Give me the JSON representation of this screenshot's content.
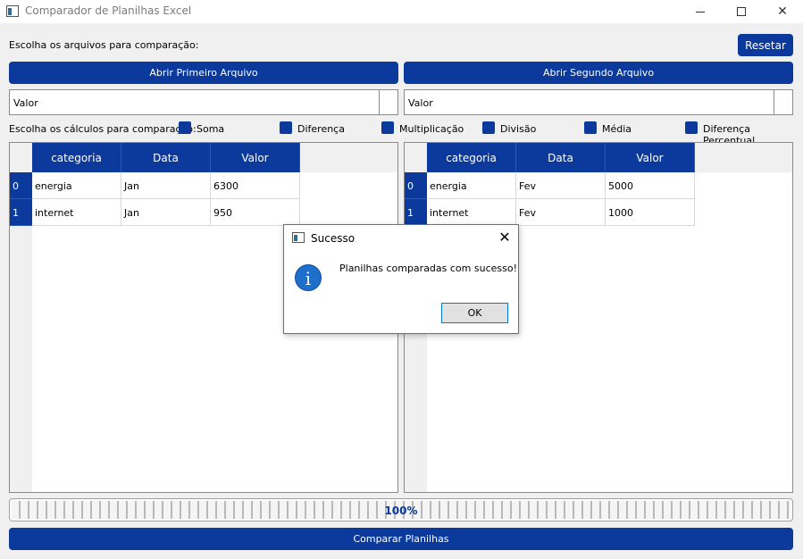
{
  "window": {
    "title": "Comparador de Planilhas Excel",
    "app_icon": "spreadsheet-icon"
  },
  "header": {
    "choose_files_label": "Escolha os arquivos para comparação:",
    "reset_button": "Resetar"
  },
  "files": {
    "open_first": "Abrir Primeiro Arquivo",
    "open_second": "Abrir Segundo Arquivo"
  },
  "columns_select": {
    "first_value": "Valor",
    "second_value": "Valor"
  },
  "calculations": {
    "label": "Escolha os cálculos para comparação:",
    "options": [
      "Soma",
      "Diferença",
      "Multiplicação",
      "Divisão",
      "Média",
      "Diferença Percentual"
    ]
  },
  "table1": {
    "headers": [
      "categoria",
      "Data",
      "Valor"
    ],
    "row_headers": [
      "0",
      "1"
    ],
    "rows": [
      [
        "energia",
        "Jan",
        "6300"
      ],
      [
        "internet",
        "Jan",
        "950"
      ]
    ]
  },
  "table2": {
    "headers": [
      "categoria",
      "Data",
      "Valor"
    ],
    "row_headers": [
      "0",
      "1"
    ],
    "rows": [
      [
        "energia",
        "Fev",
        "5000"
      ],
      [
        "internet",
        "Fev",
        "1000"
      ]
    ]
  },
  "progress": {
    "value": 100,
    "text": "100%"
  },
  "compare_button": "Comparar Planilhas",
  "dialog": {
    "title": "Sucesso",
    "message": "Planilhas comparadas com sucesso!",
    "ok": "OK",
    "icon": "info-icon"
  },
  "colors": {
    "accent": "#0b3a9c",
    "background": "#f0f0f0"
  }
}
